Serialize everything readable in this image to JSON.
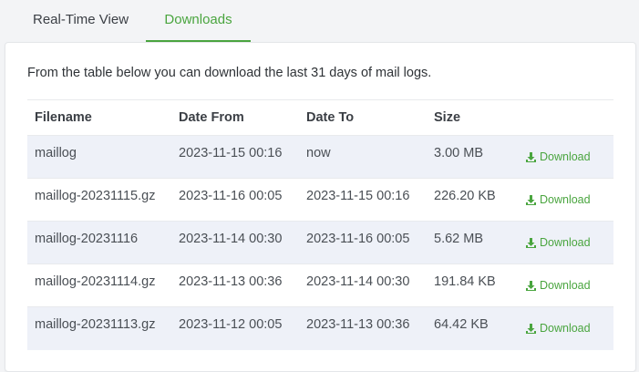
{
  "tabs": [
    {
      "label": "Real-Time View",
      "active": false
    },
    {
      "label": "Downloads",
      "active": true
    }
  ],
  "intro_text": "From the table below you can download the last 31 days of mail logs.",
  "table": {
    "headers": [
      "Filename",
      "Date From",
      "Date To",
      "Size",
      ""
    ],
    "rows": [
      {
        "filename": "maillog",
        "date_from": "2023-11-15 00:16",
        "date_to": "now",
        "size": "3.00 MB",
        "action": "Download"
      },
      {
        "filename": "maillog-20231115.gz",
        "date_from": "2023-11-16 00:05",
        "date_to": "2023-11-15 00:16",
        "size": "226.20 KB",
        "action": "Download"
      },
      {
        "filename": "maillog-20231116",
        "date_from": "2023-11-14 00:30",
        "date_to": "2023-11-16 00:05",
        "size": "5.62 MB",
        "action": "Download"
      },
      {
        "filename": "maillog-20231114.gz",
        "date_from": "2023-11-13 00:36",
        "date_to": "2023-11-14 00:30",
        "size": "191.84 KB",
        "action": "Download"
      },
      {
        "filename": "maillog-20231113.gz",
        "date_from": "2023-11-12 00:05",
        "date_to": "2023-11-13 00:36",
        "size": "64.42 KB",
        "action": "Download"
      }
    ]
  },
  "colors": {
    "accent": "#4aa53f",
    "stripe": "#eef1f8"
  },
  "icons": {
    "download": "download-icon"
  }
}
